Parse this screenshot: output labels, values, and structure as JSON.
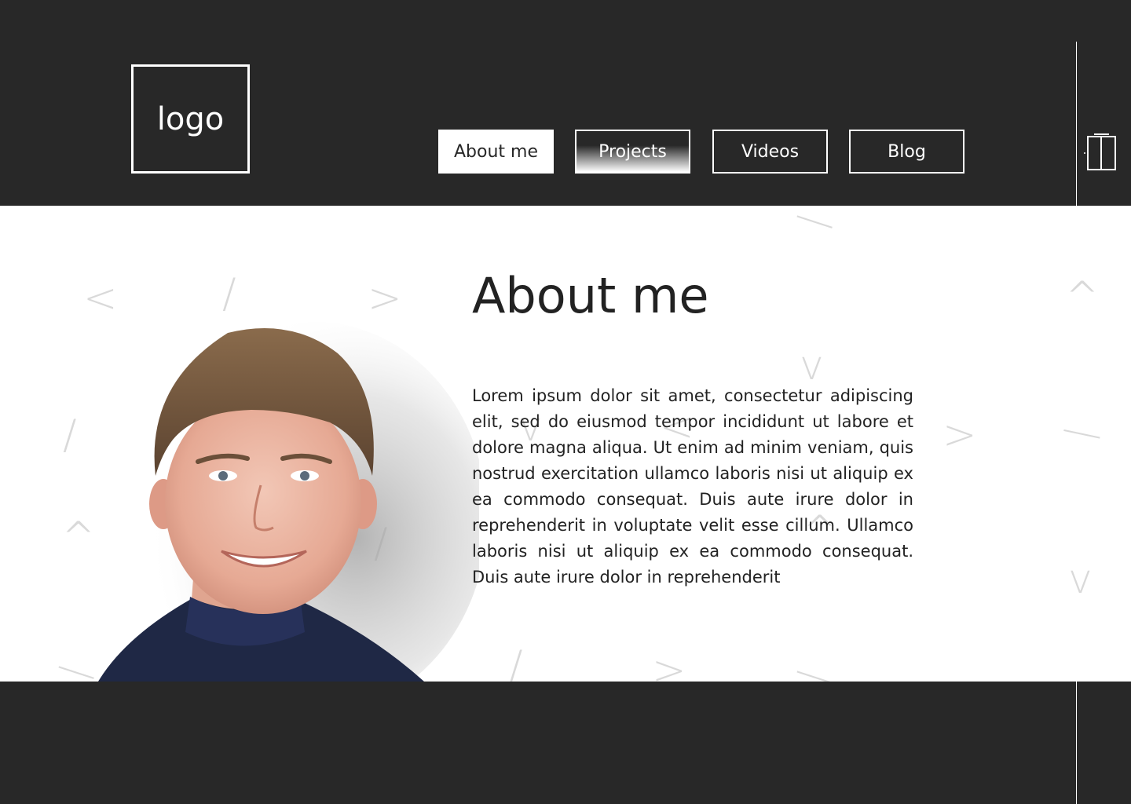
{
  "header": {
    "logo_text": "logo",
    "nav": [
      {
        "label": "About me"
      },
      {
        "label": "Projects"
      },
      {
        "label": "Videos"
      },
      {
        "label": "Blog"
      }
    ]
  },
  "main": {
    "title": "About me",
    "bio": "Lorem ipsum dolor sit amet, consectetur adipiscing elit, sed do eiusmod tempor incididunt ut labore et dolore magna aliqua. Ut enim ad minim veniam, quis nostrud exercitation ullamco laboris nisi ut aliquip ex ea commodo consequat. Duis aute irure dolor in reprehenderit in voluptate velit esse cillum. Ullamco laboris nisi ut aliquip ex ea commodo consequat. Duis aute irure dolor in reprehenderit"
  },
  "icons": {
    "side": "elevator-icon",
    "profile": "profile-photo"
  },
  "colors": {
    "dark": "#282828",
    "light": "#ffffff",
    "text": "#222222",
    "decor": "#d9d9d9"
  }
}
